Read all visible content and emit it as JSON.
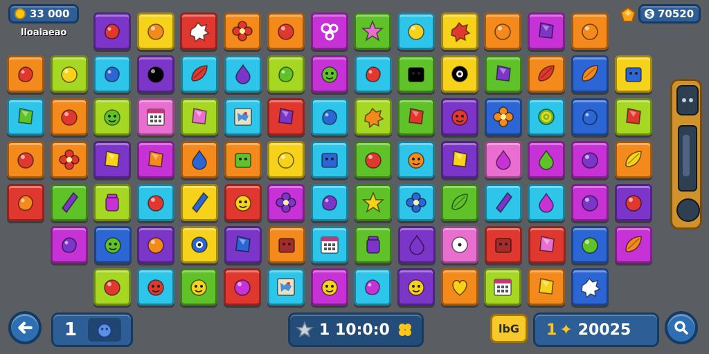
{
  "hud": {
    "coins_text": "33 000",
    "subtitle": "lloaiaeao",
    "gems_text": "70520",
    "moves_text": "1",
    "timer_text": "1 10:0:0",
    "badge_text": "lbG",
    "score_prefix": "1",
    "score_text": "20025"
  },
  "colors": {
    "panel": "#2d5f96",
    "background": "#5a5d61"
  },
  "palette": {
    "red": "#e0382e",
    "orange": "#f48a1c",
    "yellow": "#f7d21a",
    "green": "#5fc228",
    "cyan": "#2ec5ea",
    "blue": "#2b66d4",
    "purple": "#7b35c8",
    "magenta": "#c632d6",
    "pink": "#e86fd0",
    "lime": "#a6d823",
    "teal": "#26b7c8"
  },
  "board": {
    "rows": [
      [
        "purple:red-blob",
        "yellow:orange-ball",
        "red:white-splat",
        "orange:red-flower",
        "orange:red-ball",
        "magenta:white-doodle",
        "green:pink-star",
        "cyan:yellow-ball",
        "yellow:red-splat",
        "orange:orange-ball",
        "magenta:purple-gem",
        "orange:orange-ball"
      ],
      [
        "orange:red-blob",
        "lime:yellow-ball",
        "cyan:blue-blob",
        "purple:dark-ball",
        "cyan:red-leaf",
        "cyan:purple-drop",
        "lime:green-blob",
        "magenta:green-monster",
        "cyan:red-blob",
        "green:box",
        "yellow:dark-eye",
        "green:purple-gem",
        "orange:red-leaf",
        "blue:orange-leaf",
        "yellow:blue-box"
      ],
      [
        "cyan:green-gem",
        "orange:red-ball",
        "lime:green-monster",
        "pink:calendar",
        "lime:pink-gem",
        "cyan:map",
        "red:purple-gem",
        "cyan:blue-blob",
        "lime:orange-splat",
        "green:red-gem",
        "purple:red-monster",
        "blue:orange-flower",
        "cyan:green-swirl",
        "blue:blue-blob",
        "lime:red-gem"
      ],
      [
        "orange:red-ball",
        "orange:red-flower",
        "purple:yellow-gem",
        "magenta:orange-gem",
        "orange:blue-drop",
        "orange:green-box",
        "yellow:yellow-ball",
        "cyan:blue-box",
        "green:red-ball",
        "cyan:orange-monster",
        "purple:yellow-gem",
        "pink:magenta-drop",
        "magenta:green-drop",
        "magenta:purple-ball",
        "orange:yellow-leaf"
      ],
      [
        "red:orange-blob",
        "green:purple-crystal",
        "lime:magenta-jar",
        "cyan:red-ball",
        "yellow:blue-crystal",
        "red:yellow-monster",
        "magenta:purple-flower",
        "cyan:purple-blob",
        "green:yellow-star",
        "cyan:blue-flower",
        "green:green-leaf",
        "cyan:purple-crystal",
        "cyan:magenta-drop",
        "magenta:purple-ball",
        "purple:red-ball"
      ],
      [
        "magenta:purple-blob",
        "blue:green-monster",
        "purple:orange-ball",
        "yellow:blue-eye",
        "purple:blue-gem",
        "orange:brown-box",
        "cyan:calendar",
        "green:purple-jar",
        "purple:purple-drop",
        "pink:white-eye",
        "red:brown-box",
        "red:pink-gem",
        "blue:green-ball",
        "magenta:orange-leaf"
      ],
      [
        "lime:red-ball",
        "cyan:red-monster",
        "green:yellow-monster",
        "red:magenta-ball",
        "cyan:map",
        "magenta:yellow-monster",
        "cyan:magenta-blob",
        "purple:yellow-monster",
        "orange:yellow-heart",
        "lime:calendar",
        "orange:yellow-gem",
        "blue:white-splat"
      ]
    ]
  }
}
